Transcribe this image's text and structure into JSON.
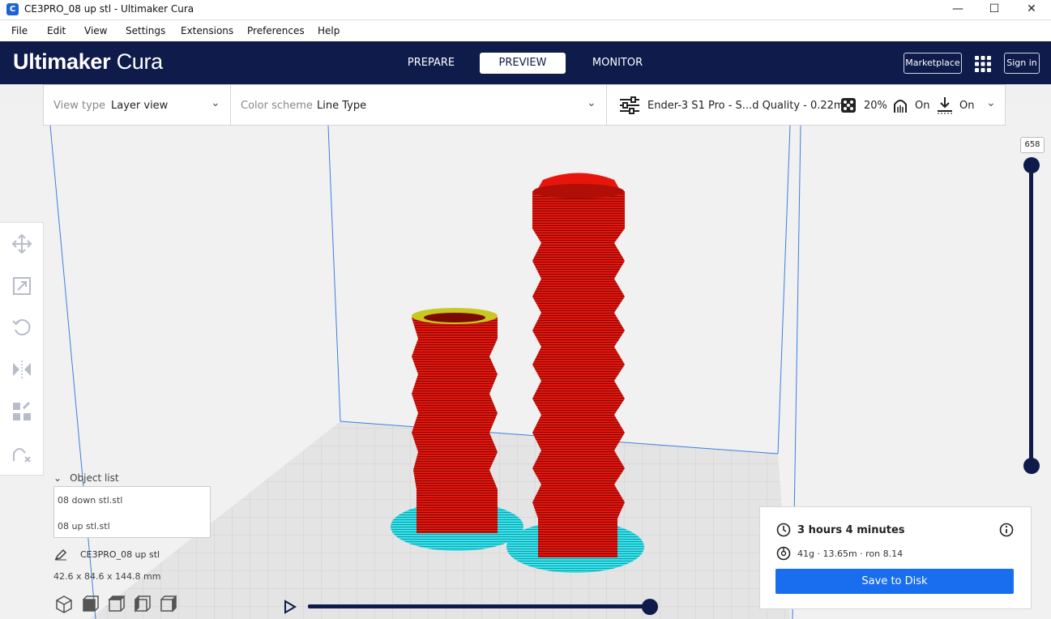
{
  "window": {
    "title": "CE3PRO_08 up stl - Ultimaker Cura"
  },
  "menu": [
    "File",
    "Edit",
    "View",
    "Settings",
    "Extensions",
    "Preferences",
    "Help"
  ],
  "header": {
    "logo_bold": "Ultimaker",
    "logo_light": "Cura",
    "stages": [
      "PREPARE",
      "PREVIEW",
      "MONITOR"
    ],
    "active_stage": "PREVIEW",
    "marketplace": "Marketplace",
    "sign_in": "Sign in"
  },
  "toolbar": {
    "view_type_label": "View type",
    "view_type_value": "Layer view",
    "color_scheme_label": "Color scheme",
    "color_scheme_value": "Line Type",
    "printer_profile": "Ender-3 S1 Pro - S...d Quality - 0.22mm",
    "infill": "20%",
    "support": "On",
    "adhesion": "On"
  },
  "layer_slider": {
    "value": "658"
  },
  "object_list": {
    "toggle_label": "Object list",
    "items": [
      "08 down stl.stl",
      "08 up stl.stl"
    ],
    "job_name": "CE3PRO_08 up stl",
    "dimensions": "42.6 x 84.6 x 144.8 mm"
  },
  "job": {
    "time": "3 hours 4 minutes",
    "material": "41g · 13.65m · ron 8.14",
    "save_label": "Save to Disk"
  },
  "colors": {
    "header_bg": "#0e1b4b",
    "accent_blue": "#196ef0",
    "print_red": "#e8150d",
    "skirt_cyan": "#30e0e8",
    "infill_yellow": "#c8d800"
  }
}
